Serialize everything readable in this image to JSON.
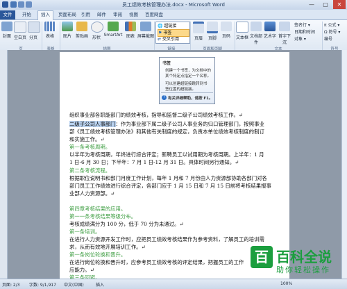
{
  "window": {
    "title": "员工绩效考核管理办法.docx - Microsoft Word",
    "min": "—",
    "max": "▢",
    "close": "✕"
  },
  "tabs": {
    "file": "文件",
    "start": "开始",
    "insert": "插入",
    "layout": "页面布局",
    "references": "引用",
    "mailings": "邮件",
    "review": "审阅",
    "view": "视图",
    "baidu": "百度网盘"
  },
  "ribbon": {
    "cover": "封面",
    "blank": "空白页",
    "break": "分页",
    "table": "表格",
    "picture": "图片",
    "clipart": "剪贴画",
    "shapes": "形状",
    "smartart": "SmartArt",
    "chart": "图表",
    "screenshot": "屏幕截图",
    "hyperlink": "超链接",
    "bookmark": "书签",
    "crossref": "交叉引用",
    "header": "页眉",
    "footer": "页脚",
    "pagenum": "页码",
    "textbox": "文本框",
    "quickparts": "文档部件",
    "wordart": "艺术字",
    "dropcap": "首字下沉",
    "signature": "签名行 ▾",
    "datetime": "日期和时间",
    "object": "对象 ▾",
    "equation": "π 公式 ▾",
    "symbol": "Ω 符号 ▾",
    "number": "编号",
    "grp_pages": "页",
    "grp_table": "表格",
    "grp_illus": "插图",
    "grp_links": "链接",
    "grp_hf": "页眉和页脚",
    "grp_text": "文本",
    "grp_symbols": "符号"
  },
  "tooltip": {
    "title": "书签",
    "line1": "创建一个书签，为文档中的",
    "line2": "某个特定点指定一个名称。",
    "line3": "可以创建超链接跳转到书",
    "line4": "签位置的超链接。",
    "help": "有关详细帮助，请按 F1。"
  },
  "doc": {
    "l1": "组织事业部各职能部门的绩效考核，指导和监督二级子公司绩效考核工作。↵",
    "l2a": "二级子公司人事部门",
    "l2b": "：作为事业部下属二级子公司人事业务的归口管理部门，按照事业",
    "l3": "部《员工绩效考核管理办法》和其他有关制度的规定，负责本单位绩效考核制度的制订",
    "l4": "和实施工作。↵",
    "l5": "第一条考核周期。",
    "l6": "以半年为考核周期，年终进行综合评定；新聘员工以试用期为考核周期。上半年：1 月",
    "l7": "1 日-6 月 30 日；下半年：7 月 1 日-12 月 31 日。具体时间另行通知。↵",
    "l8": "第二条考核流程。",
    "l9": "根据职位说明书和部门月度工作计划，每年 1 月和 7 月份由人力资源部协助各部门对各",
    "l10": "部门员工工作绩效进行综合评定，各部门应于 1 月 15 日和 7 月 15 日前将考核结果报事",
    "l11": "业部人力资源部。↵",
    "l12": "第四章考核结果的应用。",
    "l13": "第一一条考核结果等级分布。",
    "l14": "考核成绩满分为 100 分，低于 70 分为未通过。↵",
    "l15": "第一条培训。",
    "l16": "在进行人力资源开发工作时，应把员工绩效考核结果作为参考资料，了解员工的培训需",
    "l17": "求，从而有效地开展培训工作。↵",
    "l18": "第一条岗位轮换和晋升。",
    "l19": "在进行岗位轮换和晋升时，应参考员工绩效考核的评定结果，把握员工的工作",
    "l20": "应能力。↵",
    "l21": "第三条回避。"
  },
  "status": {
    "page": "页面: 2/3",
    "words": "字数: 9/1,917",
    "lang": "中文(中国)",
    "mode": "插入",
    "zoom": "100%"
  },
  "watermark": {
    "logo": "百",
    "brand": "百科全说",
    "slogan": "助你轻松操作"
  }
}
